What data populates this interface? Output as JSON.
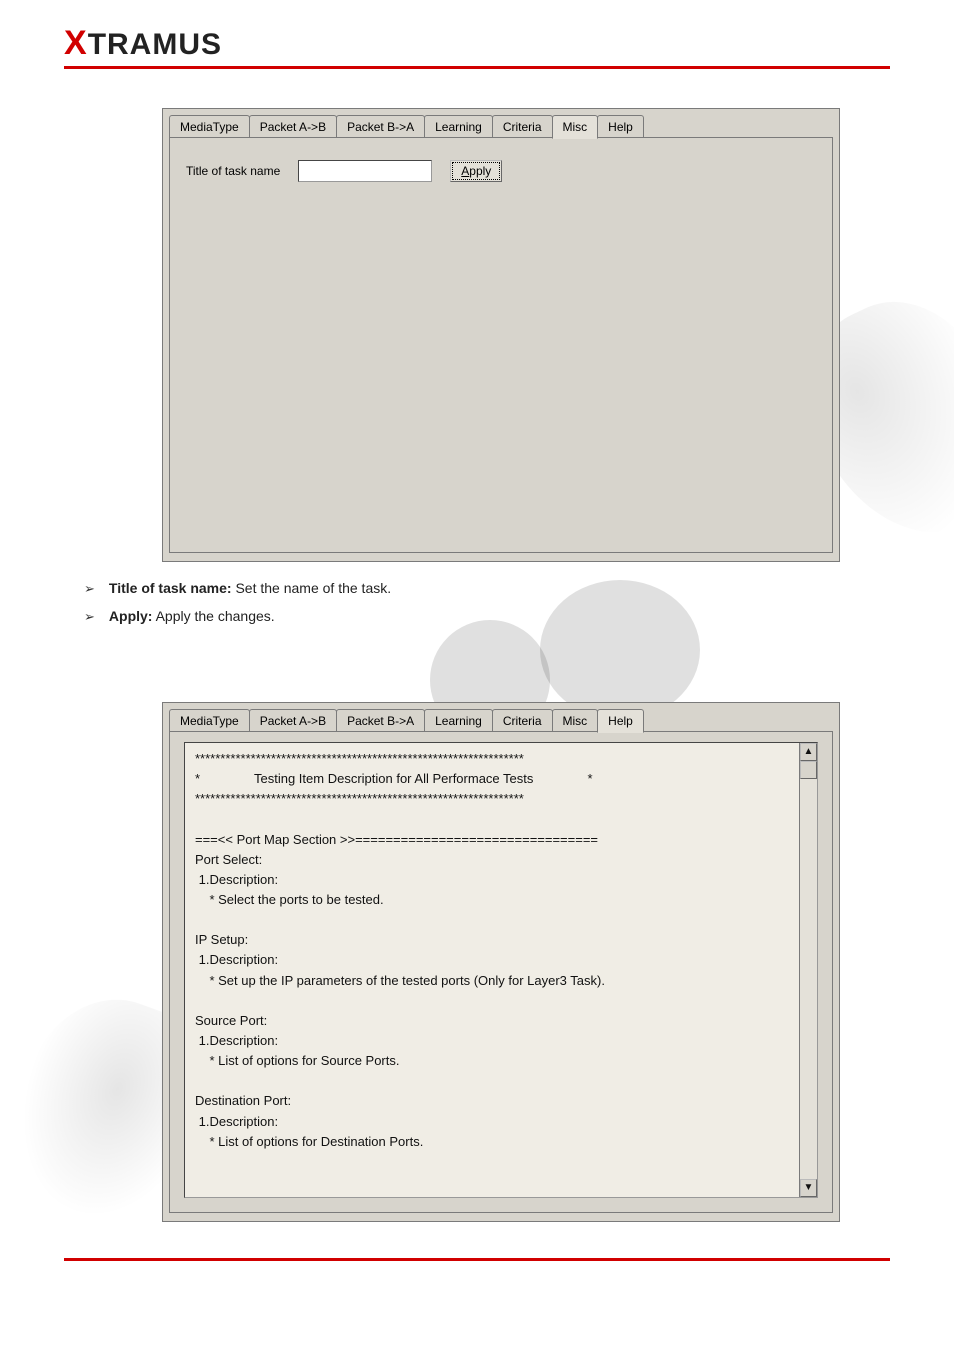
{
  "logo": {
    "x": "X",
    "rest": "TRAMUS"
  },
  "tabs": [
    "MediaType",
    "Packet A->B",
    "Packet B->A",
    "Learning",
    "Criteria",
    "Misc",
    "Help"
  ],
  "misc_panel": {
    "active_tab": "Misc",
    "title_label": "Title of task name",
    "title_value": "",
    "apply_prefix": "A",
    "apply_rest": "pply"
  },
  "bullets": [
    {
      "label": "Title of task name:",
      "desc": " Set the name of the task."
    },
    {
      "label": "Apply:",
      "desc": " Apply the changes."
    }
  ],
  "help_panel": {
    "active_tab": "Help",
    "text": "*****************************************************************\n*               Testing Item Description for All Performace Tests               *\n*****************************************************************\n\n===<< Port Map Section >>================================\nPort Select:\n 1.Description:\n    * Select the ports to be tested.\n\nIP Setup:\n 1.Description:\n    * Set up the IP parameters of the tested ports (Only for Layer3 Task).\n\nSource Port:\n 1.Description:\n    * List of options for Source Ports.\n\nDestination Port:\n 1.Description:\n    * List of options for Destination Ports."
  }
}
